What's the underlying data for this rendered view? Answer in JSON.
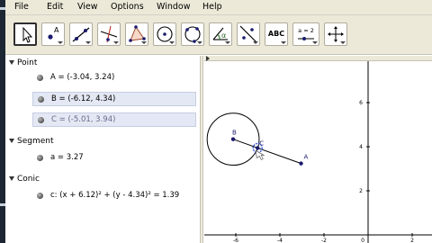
{
  "menubar": {
    "items": [
      "File",
      "Edit",
      "View",
      "Options",
      "Window",
      "Help"
    ]
  },
  "toolbar": {
    "tools": [
      {
        "name": "move-tool",
        "icon": "arrow-cursor-icon",
        "active": true
      },
      {
        "name": "new-point-tool",
        "icon": "point-icon",
        "label": "A"
      },
      {
        "name": "line-tool",
        "icon": "line-through-two-points-icon"
      },
      {
        "name": "perpendicular-line-tool",
        "icon": "perpendicular-line-icon"
      },
      {
        "name": "polygon-tool",
        "icon": "polygon-icon"
      },
      {
        "name": "circle-center-point-tool",
        "icon": "circle-center-point-icon"
      },
      {
        "name": "circle-three-points-tool",
        "icon": "circle-three-points-icon"
      },
      {
        "name": "angle-tool",
        "icon": "angle-icon",
        "label": "α"
      },
      {
        "name": "reflect-tool",
        "icon": "reflect-about-line-icon"
      },
      {
        "name": "text-tool",
        "icon": "text-icon",
        "label": "ABC"
      },
      {
        "name": "slider-tool",
        "icon": "slider-icon",
        "label": "a = 2"
      },
      {
        "name": "move-graphics-view-tool",
        "icon": "move-view-arrows-icon"
      }
    ]
  },
  "algebra": {
    "categories": [
      {
        "title": "Point",
        "items": [
          {
            "text": "A = (-3.04, 3.24)",
            "state": "normal"
          },
          {
            "text": "B = (-6.12, 4.34)",
            "state": "selected"
          },
          {
            "text": "C = (-5.01, 3.94)",
            "state": "dim"
          }
        ]
      },
      {
        "title": "Segment",
        "items": [
          {
            "text": "a = 3.27",
            "state": "normal"
          }
        ]
      },
      {
        "title": "Conic",
        "items": [
          {
            "text": "c: (x + 6.12)² + (y - 4.34)² = 1.39",
            "state": "normal"
          }
        ]
      }
    ]
  },
  "graphics": {
    "x_ticks": [
      "-6",
      "-4",
      "-2",
      "0",
      "2"
    ],
    "y_ticks": [
      "6",
      "4",
      "2"
    ],
    "origin_label": "0",
    "points": [
      {
        "label": "A",
        "x": -3.04,
        "y": 3.24
      },
      {
        "label": "B",
        "x": -6.12,
        "y": 4.34
      },
      {
        "label": "C",
        "x": -5.01,
        "y": 3.94
      }
    ],
    "circle": {
      "center": "B",
      "r2": 1.39
    },
    "segment": {
      "from": "B",
      "to": "A",
      "label": "a"
    },
    "colors": {
      "point": "#1a1a6e",
      "line": "#000000",
      "highlight": "#3c5cd8"
    }
  }
}
